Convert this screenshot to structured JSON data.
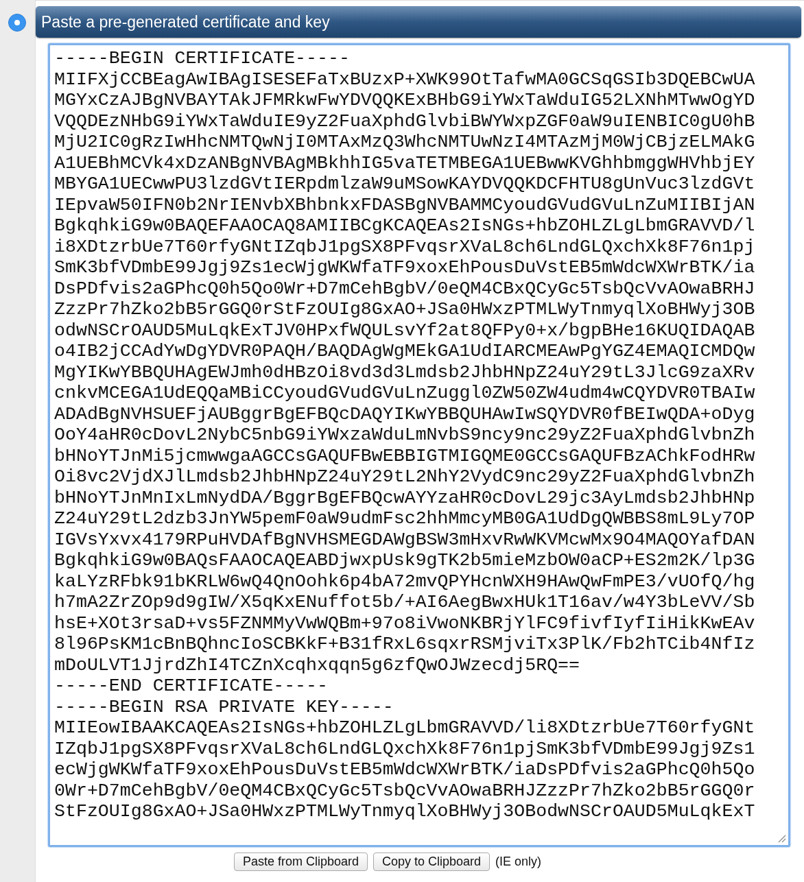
{
  "option": {
    "label": "Paste a pre-generated certificate and key",
    "selected": true
  },
  "certificate_field": {
    "value": "-----BEGIN CERTIFICATE-----\nMIIFXjCCBEagAwIBAgISESEFaTxBUzxP+XWK99OtTafwMA0GCSqGSIb3DQEBCwUA\nMGYxCzAJBgNVBAYTAkJFMRkwFwYDVQQKExBHbG9iYWxTaWduIG52LXNhMTwwOgYD\nVQQDEzNHbG9iYWxTaWduIE9yZ2FuaXphdGlvbiBWYWxpZGF0aW9uIENBIC0gU0hB\nMjU2IC0gRzIwHhcNMTQwNjI0MTAxMzQ3WhcNMTUwNzI4MTAzMjM0WjCBjzELMAkG\nA1UEBhMCVk4xDzANBgNVBAgMBkhhIG5vaTETMBEGA1UEBwwKVGhhbmggWHVhbjEY\nMBYGA1UECwwPU3lzdGVtIERpdmlzaW9uMSowKAYDVQQKDCFHTU8gUnVuc3lzdGVt\nIEpvaW50IFN0b2NrIENvbXBhbnkxFDASBgNVBAMMCyoudGVudGVuLnZuMIIBIjAN\nBgkqhkiG9w0BAQEFAAOCAQ8AMIIBCgKCAQEAs2IsNGs+hbZOHLZLgLbmGRAVVD/l\ni8XDtzrbUe7T60rfyGNtIZqbJ1pgSX8PFvqsrXVaL8ch6LndGLQxchXk8F76n1pj\nSmK3bfVDmbE99Jgj9Zs1ecWjgWKWfaTF9xoxEhPousDuVstEB5mWdcWXWrBTK/ia\nDsPDfvis2aGPhcQ0h5Qo0Wr+D7mCehBgbV/0eQM4CBxQCyGc5TsbQcVvAOwaBRHJ\nZzzPr7hZko2bB5rGGQ0rStFzOUIg8GxAO+JSa0HWxzPTMLWyTnmyqlXoBHWyj3OB\nodwNSCrOAUD5MuLqkExTJV0HPxfWQULsvYf2at8QFPy0+x/bgpBHe16KUQIDAQAB\no4IB2jCCAdYwDgYDVR0PAQH/BAQDAgWgMEkGA1UdIARCMEAwPgYGZ4EMAQICMDQw\nMgYIKwYBBQUHAgEWJmh0dHBzOi8vd3d3Lmdsb2JhbHNpZ24uY29tL3JlcG9zaXRv\ncnkvMCEGA1UdEQQaMBiCCyoudGVudGVuLnZuggl0ZW50ZW4udm4wCQYDVR0TBAIw\nADAdBgNVHSUEFjAUBggrBgEFBQcDAQYIKwYBBQUHAwIwSQYDVR0fBEIwQDA+oDyg\nOoY4aHR0cDovL2NybC5nbG9iYWxzaWduLmNvbS9ncy9nc29yZ2FuaXphdGlvbnZh\nbHNoYTJnMi5jcmwwgaAGCCsGAQUFBwEBBIGTMIGQME0GCCsGAQUFBzAChkFodHRw\nOi8vc2VjdXJlLmdsb2JhbHNpZ24uY29tL2NhY2VydC9nc29yZ2FuaXphdGlvbnZh\nbHNoYTJnMnIxLmNydDA/BggrBgEFBQcwAYYzaHR0cDovL29jc3AyLmdsb2JhbHNp\nZ24uY29tL2dzb3JnYW5pemF0aW9udmFsc2hhMmcyMB0GA1UdDgQWBBS8mL9Ly7OP\nIGVsYxvx4179RPuHVDAfBgNVHSMEGDAWgBSW3mHxvRwWKVMcwMx9O4MAQOYafDAN\nBgkqhkiG9w0BAQsFAAOCAQEABDjwxpUsk9gTK2b5mieMzbOW0aCP+ES2m2K/lp3G\nkaLYzRFbk91bKRLW6wQ4QnOohk6p4bA72mvQPYHcnWXH9HAwQwFmPE3/vUOfQ/hg\nh7mA2ZrZOp9d9gIW/X5qKxENuffot5b/+AI6AegBwxHUk1T16av/w4Y3bLeVV/Sb\nhsE+XOt3rsaD+vs5FZNMMyVwWQBm+97o8iVwoNKBRjYlFC9fivfIyfIiHikKwEAv\n8l96PsKM1cBnBQhncIoSCBKkF+B31fRxL6sqxrRSMjviTx3PlK/Fb2hTCib4NfIz\nmDoULVT1JjrdZhI4TCZnXcqhxqqn5g6zfQwOJWzecdj5RQ==\n-----END CERTIFICATE-----\n-----BEGIN RSA PRIVATE KEY-----\nMIIEowIBAAKCAQEAs2IsNGs+hbZOHLZLgLbmGRAVVD/li8XDtzrbUe7T60rfyGNt\nIZqbJ1pgSX8PFvqsrXVaL8ch6LndGLQxchXk8F76n1pjSmK3bfVDmbE99Jgj9Zs1\necWjgWKWfaTF9xoxEhPousDuVstEB5mWdcWXWrBTK/iaDsPDfvis2aGPhcQ0h5Qo\n0Wr+D7mCehBgbV/0eQM4CBxQCyGc5TsbQcVvAOwaBRHJZzzPr7hZko2bB5rGGQ0r\nStFzOUIg8GxAO+JSa0HWxzPTMLWyTnmyqlXoBHWyj3OBodwNSCrOAUD5MuLqkExT"
  },
  "buttons": [
    {
      "label": "Paste from Clipboard"
    },
    {
      "label": "Copy to Clipboard"
    }
  ],
  "note": "(IE only)"
}
